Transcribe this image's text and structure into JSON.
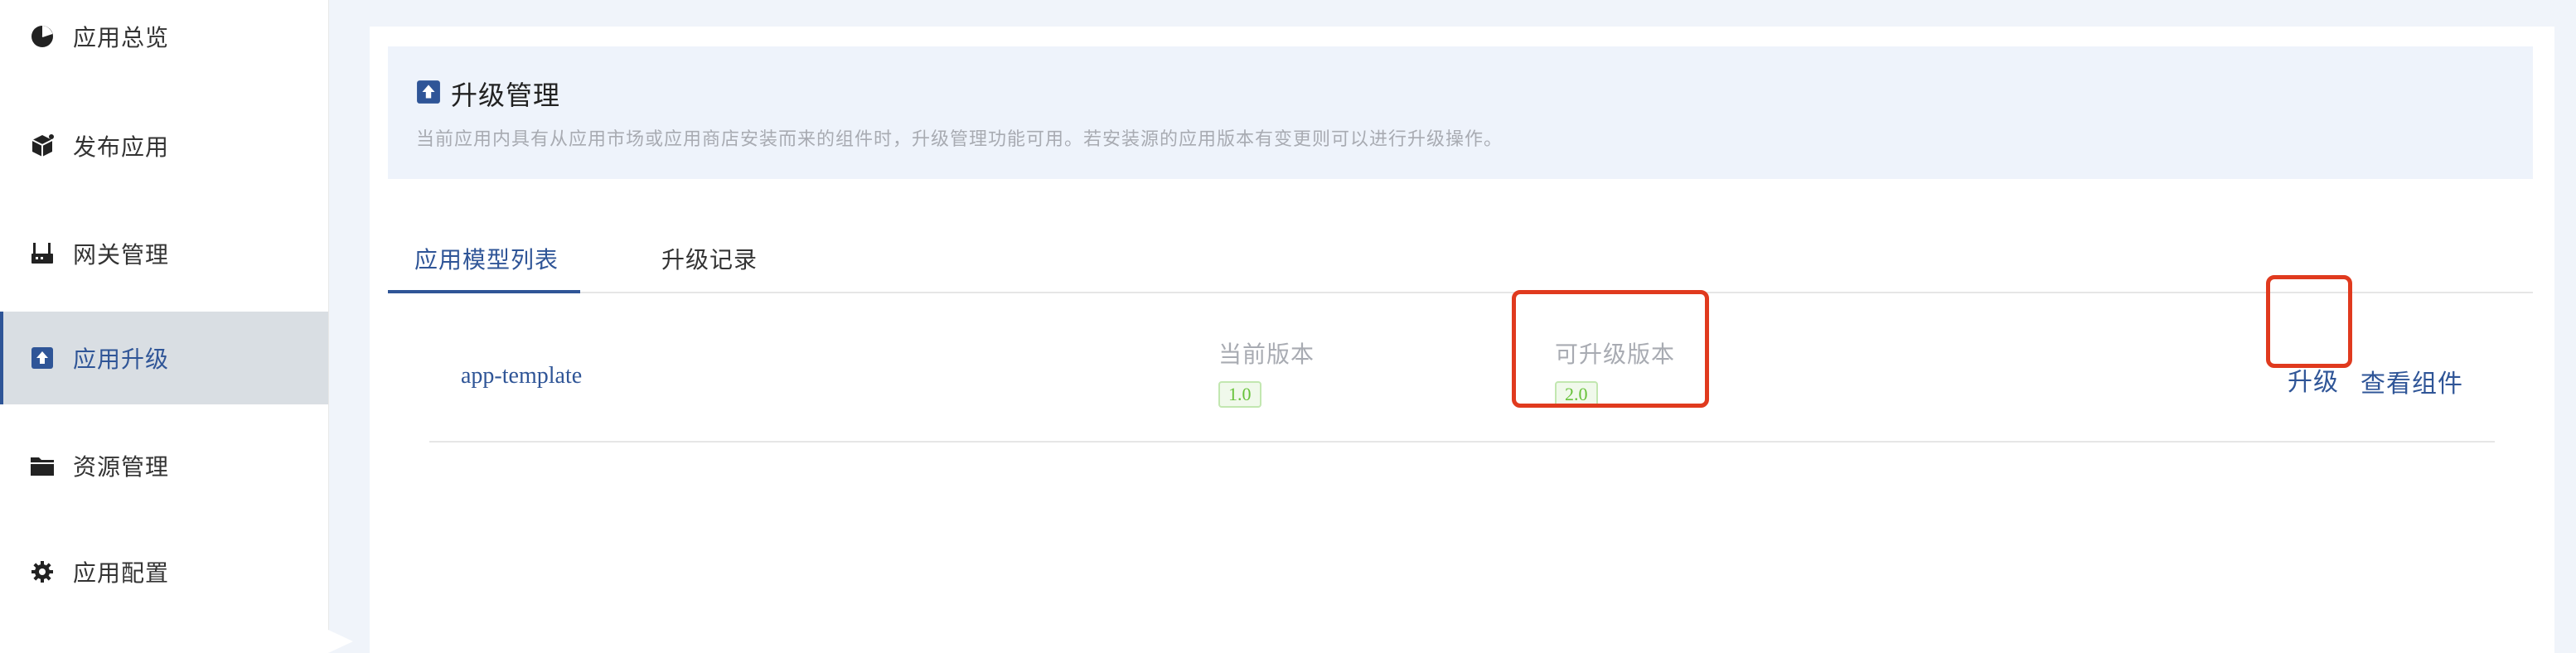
{
  "sidebar": {
    "items": [
      {
        "label": "应用总览",
        "icon": "pie-chart-icon"
      },
      {
        "label": "发布应用",
        "icon": "cube-icon"
      },
      {
        "label": "网关管理",
        "icon": "router-icon"
      },
      {
        "label": "应用升级",
        "icon": "upload-icon",
        "active": true
      },
      {
        "label": "资源管理",
        "icon": "folder-icon"
      },
      {
        "label": "应用配置",
        "icon": "gear-icon"
      }
    ]
  },
  "info": {
    "title": "升级管理",
    "description": "当前应用内具有从应用市场或应用商店安装而来的组件时，升级管理功能可用。若安装源的应用版本有变更则可以进行升级操作。"
  },
  "tabs": [
    {
      "label": "应用模型列表",
      "active": true
    },
    {
      "label": "升级记录",
      "active": false
    }
  ],
  "rows": [
    {
      "app_name": "app-template",
      "current_version_label": "当前版本",
      "current_version": "1.0",
      "upgradable_version_label": "可升级版本",
      "upgradable_version": "2.0",
      "upgrade_label": "升级",
      "view_components_label": "查看组件"
    }
  ],
  "colors": {
    "accent": "#2f5597",
    "highlight": "#e03a1e",
    "badge_text": "#67c23a"
  }
}
